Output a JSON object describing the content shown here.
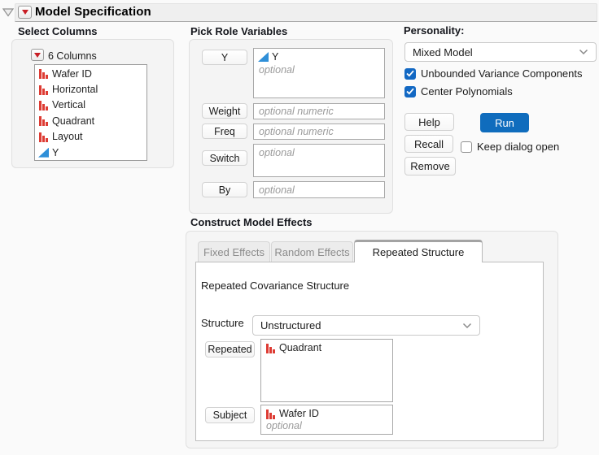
{
  "window": {
    "title": "Model Specification"
  },
  "select_columns": {
    "header": "Select Columns",
    "count_label": "6 Columns",
    "columns": [
      {
        "name": "Wafer ID",
        "type": "nominal"
      },
      {
        "name": "Horizontal",
        "type": "nominal"
      },
      {
        "name": "Vertical",
        "type": "nominal"
      },
      {
        "name": "Quadrant",
        "type": "nominal"
      },
      {
        "name": "Layout",
        "type": "nominal"
      },
      {
        "name": "Y",
        "type": "continuous"
      }
    ]
  },
  "pick_roles": {
    "header": "Pick Role Variables",
    "y": {
      "button": "Y",
      "items": [
        {
          "name": "Y",
          "type": "continuous"
        }
      ],
      "placeholder": "optional"
    },
    "weight": {
      "button": "Weight",
      "placeholder": "optional numeric"
    },
    "freq": {
      "button": "Freq",
      "placeholder": "optional numeric"
    },
    "switch": {
      "button": "Switch",
      "placeholder": "optional"
    },
    "by": {
      "button": "By",
      "placeholder": "optional"
    }
  },
  "personality": {
    "label": "Personality:",
    "selected": "Mixed Model",
    "checkboxes": [
      {
        "label": "Unbounded Variance Components",
        "checked": true
      },
      {
        "label": "Center Polynomials",
        "checked": true
      }
    ],
    "help": "Help",
    "run": "Run",
    "recall": "Recall",
    "remove": "Remove",
    "keep_dialog": {
      "label": "Keep dialog open",
      "checked": false
    }
  },
  "model_effects": {
    "header": "Construct Model Effects",
    "tabs": [
      {
        "label": "Fixed Effects",
        "active": false
      },
      {
        "label": "Random Effects",
        "active": false
      },
      {
        "label": "Repeated Structure",
        "active": true
      }
    ],
    "repeated_structure": {
      "section_label": "Repeated Covariance Structure",
      "structure_label": "Structure",
      "structure_value": "Unstructured",
      "repeated_button": "Repeated",
      "repeated_items": [
        {
          "name": "Quadrant",
          "type": "nominal"
        }
      ],
      "subject_button": "Subject",
      "subject_items": [
        {
          "name": "Wafer ID",
          "type": "nominal"
        }
      ],
      "subject_placeholder": "optional"
    }
  },
  "colors": {
    "run_blue": "#0f6cbd",
    "checkbox_blue": "#1268c3",
    "nominal_red": "#dd3b33",
    "continuous_blue": "#2f8fd8"
  }
}
